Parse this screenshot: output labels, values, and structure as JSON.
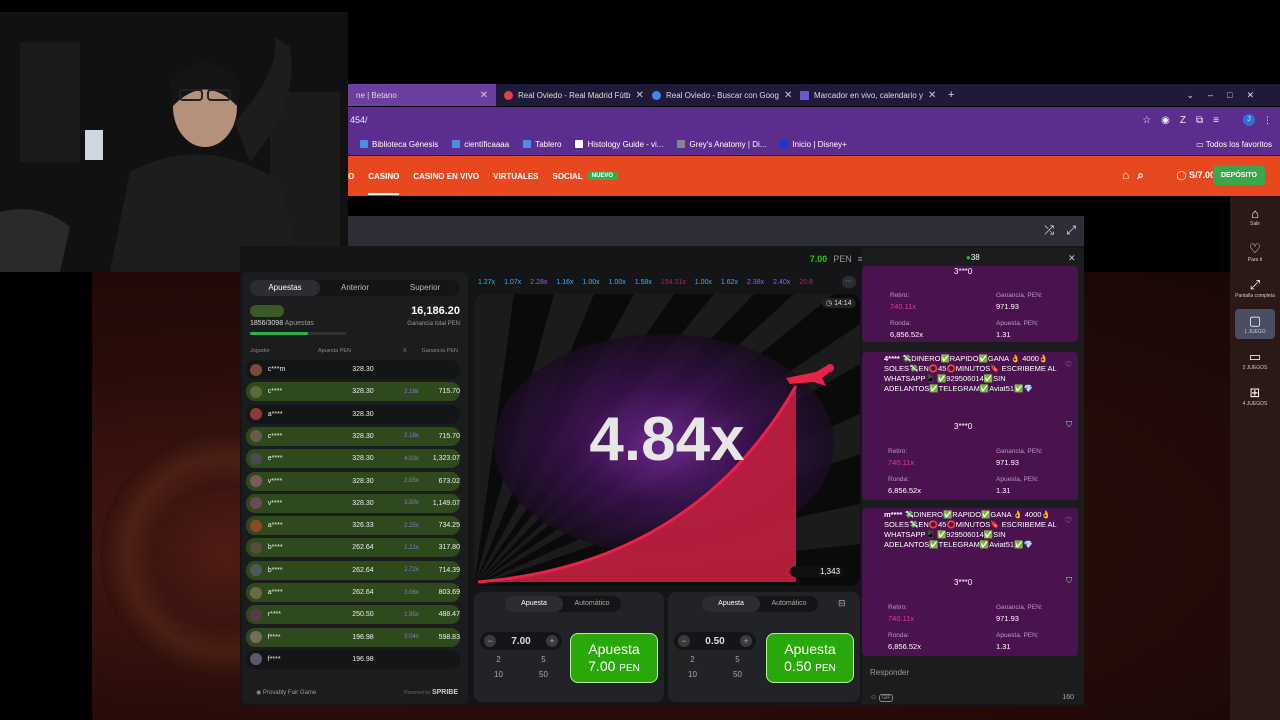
{
  "browser": {
    "tabs": [
      {
        "label": "ne | Betano",
        "active": true
      },
      {
        "label": "Real Oviedo - Real Madrid Fútb",
        "active": false
      },
      {
        "label": "Real Oviedo - Buscar con Goog",
        "active": false
      },
      {
        "label": "Marcador en vivo, calendario y",
        "active": false
      }
    ],
    "new_tab": "+",
    "url": "454/",
    "bookmarks": [
      "Biblioteca Génesis",
      "científicaaaa",
      "Tablero",
      "Histology Guide - vi...",
      "Grey's Anatomy | Di...",
      "Inicio | Disney+"
    ],
    "all_bookmarks": "Todos los favoritos",
    "profile_letter": "J"
  },
  "site": {
    "nav": [
      {
        "label": "O",
        "active": false
      },
      {
        "label": "CASINO",
        "active": true
      },
      {
        "label": "CASINO EN VIVO",
        "active": false
      },
      {
        "label": "VIRTUALES",
        "active": false
      },
      {
        "label": "SOCIAL",
        "active": false
      }
    ],
    "social_badge": "NUEVO",
    "balance": "S/7.00",
    "deposit": "DEPÓSITO"
  },
  "rail": [
    {
      "label": "Salir",
      "icon": "home-icon"
    },
    {
      "label": "Para ti",
      "icon": "heart-icon"
    },
    {
      "label": "Pantalla completa",
      "icon": "expand-icon"
    },
    {
      "label": "1 JUEGO",
      "icon": "single-game-icon",
      "selected": true
    },
    {
      "label": "2 JUEGOS",
      "icon": "two-games-icon"
    },
    {
      "label": "4 JUEGOS",
      "icon": "four-games-icon"
    }
  ],
  "game": {
    "balance": "7.00",
    "currency": "PEN",
    "history": [
      {
        "v": "1.27x",
        "c": "#34b4ff"
      },
      {
        "v": "1.07x",
        "c": "#34b4ff"
      },
      {
        "v": "2.28x",
        "c": "#9b59ff"
      },
      {
        "v": "1.16x",
        "c": "#34b4ff"
      },
      {
        "v": "1.00x",
        "c": "#34b4ff"
      },
      {
        "v": "1.00x",
        "c": "#34b4ff"
      },
      {
        "v": "1.58x",
        "c": "#34b4ff"
      },
      {
        "v": "154.31x",
        "c": "#c01780"
      },
      {
        "v": "1.00x",
        "c": "#34b4ff"
      },
      {
        "v": "1.62x",
        "c": "#34b4ff"
      },
      {
        "v": "2.38x",
        "c": "#9b59ff"
      },
      {
        "v": "2.40x",
        "c": "#9b59ff"
      },
      {
        "v": "20.8",
        "c": "#c01780"
      }
    ],
    "timer": "14:14",
    "multiplier": "4.84x",
    "players_online": "1,343"
  },
  "bets": {
    "tabs": [
      "Apuestas",
      "Anterior",
      "Superior"
    ],
    "count": "1856/3098",
    "count_label": "Apuestas",
    "total": "16,186.20",
    "total_label": "Ganancia total PEN",
    "headers": [
      "Jugador",
      "Apuesta PEN",
      "X",
      "Ganancia PEN"
    ],
    "progress": 0.6,
    "rows": [
      {
        "name": "c***m",
        "bet": "328.30",
        "mult": "",
        "win": ""
      },
      {
        "name": "c****",
        "bet": "328.30",
        "mult": "2.18x",
        "win": "715.70"
      },
      {
        "name": "a****",
        "bet": "328.30",
        "mult": "",
        "win": ""
      },
      {
        "name": "c****",
        "bet": "328.30",
        "mult": "2.18x",
        "win": "715.70"
      },
      {
        "name": "e****",
        "bet": "328.30",
        "mult": "4.03x",
        "win": "1,323.07"
      },
      {
        "name": "v****",
        "bet": "328.30",
        "mult": "2.05x",
        "win": "673.02"
      },
      {
        "name": "v****",
        "bet": "328.30",
        "mult": "3.50x",
        "win": "1,149.07"
      },
      {
        "name": "a****",
        "bet": "326.33",
        "mult": "2.25x",
        "win": "734.25"
      },
      {
        "name": "b****",
        "bet": "262.64",
        "mult": "1.21x",
        "win": "317.80"
      },
      {
        "name": "b****",
        "bet": "262.64",
        "mult": "2.72x",
        "win": "714.39"
      },
      {
        "name": "a****",
        "bet": "262.64",
        "mult": "3.06x",
        "win": "803.69"
      },
      {
        "name": "r****",
        "bet": "250.50",
        "mult": "1.95x",
        "win": "488.47"
      },
      {
        "name": "f****",
        "bet": "196.98",
        "mult": "3.04x",
        "win": "598.83"
      },
      {
        "name": "f****",
        "bet": "196.98",
        "mult": "",
        "win": ""
      }
    ],
    "footer": "Provably Fair Game",
    "powered": "Powered by",
    "brand": "SPRIBE"
  },
  "controls": [
    {
      "modes": [
        "Apuesta",
        "Automático"
      ],
      "amount": "7.00",
      "quick": [
        "2",
        "5",
        "10",
        "50"
      ],
      "btn": "Apuesta",
      "btn_amount": "7.00",
      "currency": "PEN"
    },
    {
      "modes": [
        "Apuesta",
        "Automático"
      ],
      "amount": "0.50",
      "quick": [
        "2",
        "5",
        "10",
        "50"
      ],
      "btn": "Apuesta",
      "btn_amount": "0.50",
      "currency": "PEN"
    }
  ],
  "chat": {
    "online": "38",
    "cards": [
      {
        "user": "",
        "msg": "",
        "retiro": "740.11x",
        "ganancia": "971.93",
        "ronda": "6,856.52x",
        "apuesta": "1.31",
        "winner": "3***0"
      },
      {
        "user": "4****",
        "msg": "💸DINERO✅RAPIDO✅GANA 👌 4000👌SOLES💸EN⭕45⭕MINUTOS🔖 ESCRIBEME AL WHATSAPP📱 ✅929506014✅SIN ADELANTOS✅TELEGRAM✅Aviat51✅💎",
        "retiro": "740.11x",
        "ganancia": "971.93",
        "ronda": "6,856.52x",
        "apuesta": "1.31",
        "winner": "3***0"
      },
      {
        "user": "m****",
        "msg": "💸DINERO✅RAPIDO✅GANA 👌 4000👌SOLES💸EN⭕45⭕MINUTOS🔖 ESCRIBEME AL WHATSAPP📱 ✅929506014✅SIN ADELANTOS✅TELEGRAM✅Aviat51✅💎",
        "retiro": "740.11x",
        "ganancia": "971.93",
        "ronda": "6,856.52x",
        "apuesta": "1.31",
        "winner": "3***0"
      }
    ],
    "labels": {
      "retiro": "Retiro:",
      "ganancia": "Ganancia, PEN:",
      "ronda": "Ronda:",
      "apuesta": "Apuesta, PEN:"
    },
    "reply_placeholder": "Responder",
    "gif": "GIF",
    "chars": "160"
  }
}
